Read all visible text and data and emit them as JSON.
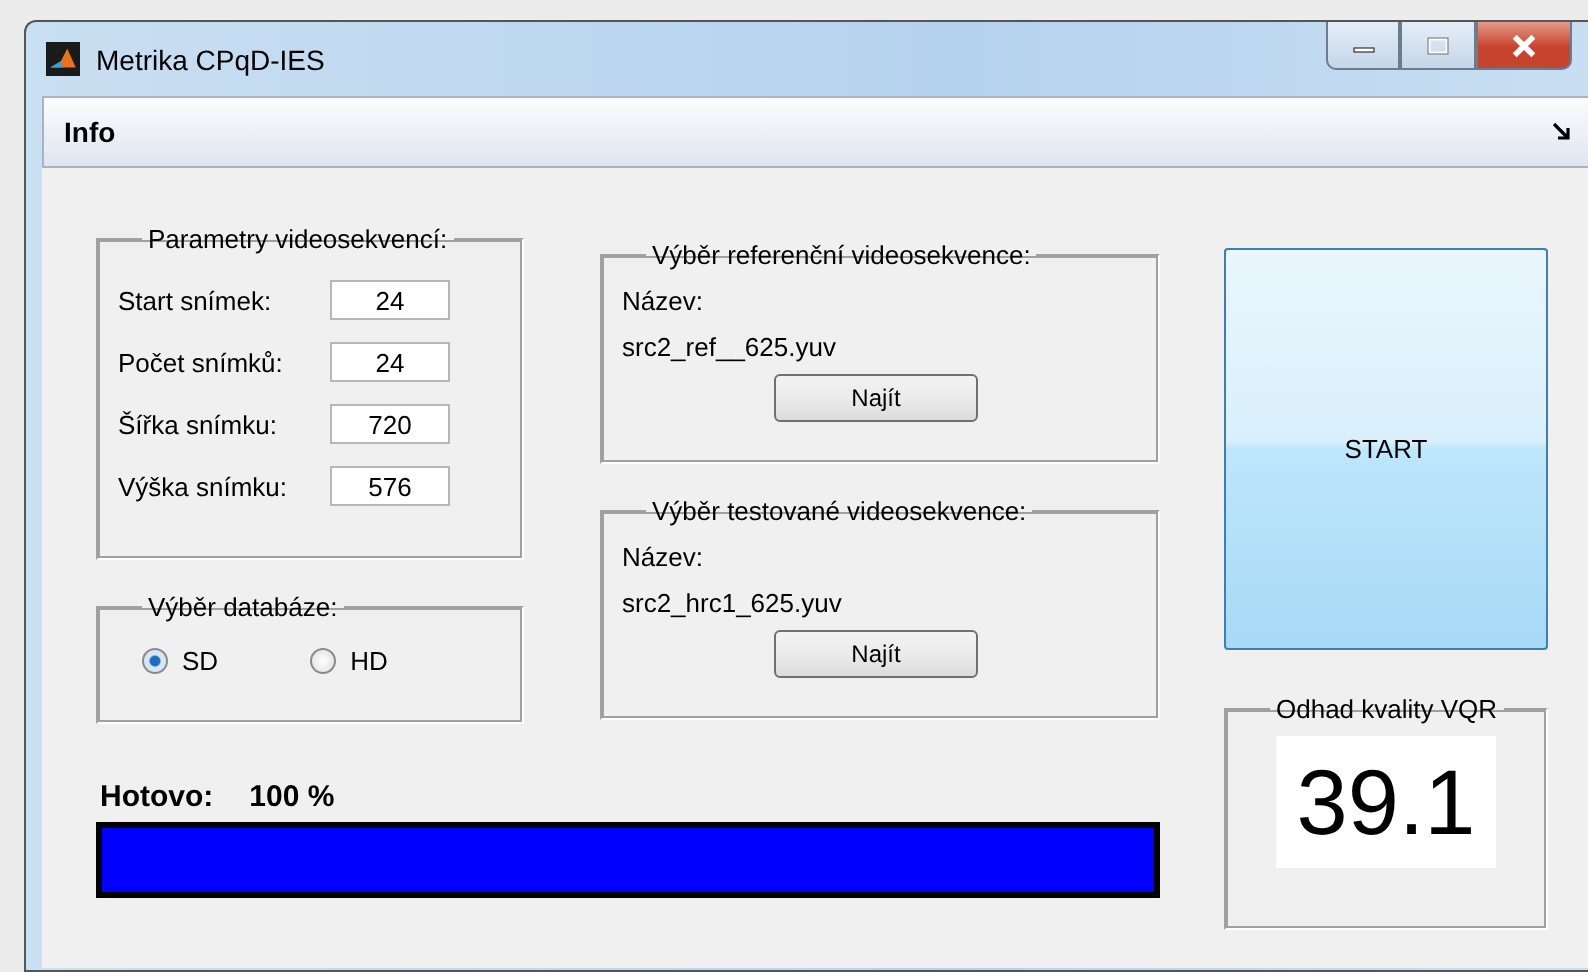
{
  "window": {
    "title": "Metrika CPqD-IES"
  },
  "menu": [
    {
      "label": "Info"
    }
  ],
  "parameters": {
    "title": "Parametry videosekvencí:",
    "fields": [
      {
        "label": "Start snímek:",
        "value": "24"
      },
      {
        "label": "Počet snímků:",
        "value": "24"
      },
      {
        "label": "Šířka snímku:",
        "value": "720"
      },
      {
        "label": "Výška snímku:",
        "value": "576"
      }
    ]
  },
  "database": {
    "title": "Výběr databáze:",
    "options": [
      {
        "label": "SD",
        "selected": true
      },
      {
        "label": "HD",
        "selected": false
      }
    ]
  },
  "reference": {
    "title": "Výběr referenční videosekvence:",
    "name_label": "Název:",
    "file": "src2_ref__625.yuv",
    "button": "Najít"
  },
  "test": {
    "title": "Výběr testované videosekvence:",
    "name_label": "Název:",
    "file": "src2_hrc1_625.yuv",
    "button": "Najít"
  },
  "start_button": "START",
  "quality": {
    "title": "Odhad kvality VQR",
    "value": "39.1"
  },
  "progress": {
    "label": "Hotovo:",
    "reading": "100  %",
    "level": 1
  }
}
